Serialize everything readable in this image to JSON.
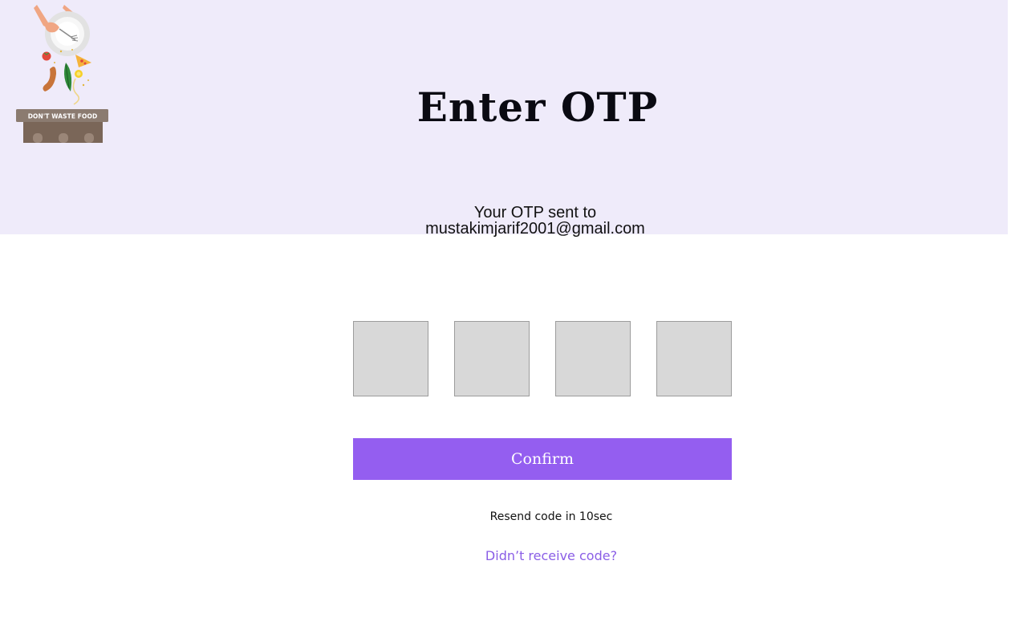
{
  "logo": {
    "banner_text": "DON'T WASTE FOOD",
    "icon": "dont-waste-food-logo"
  },
  "header": {
    "title": "Enter OTP",
    "sent_line_1": "Your OTP sent to",
    "sent_email": "mustakimjarif2001@gmail.com"
  },
  "otp": {
    "digits": [
      "",
      "",
      "",
      ""
    ]
  },
  "actions": {
    "confirm_label": "Confirm",
    "resend_text": "Resend code in 10sec",
    "didnt_receive": "Didn’t receive code?"
  },
  "colors": {
    "hero_bg": "#efebfa",
    "accent": "#945ef0",
    "link": "#8a5ee6",
    "otp_box": "#d8d8d8"
  }
}
